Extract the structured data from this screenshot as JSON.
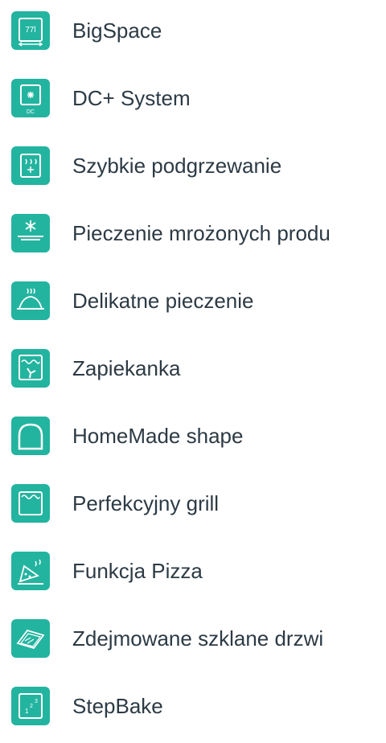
{
  "colors": {
    "icon_background": "#23b4a0",
    "icon_stroke": "#ffffff",
    "label_text": "#2c3a44"
  },
  "features": [
    {
      "label": "BigSpace",
      "icon": "bigspace-oven-icon"
    },
    {
      "label": "DC+ System",
      "icon": "dc-system-icon"
    },
    {
      "label": "Szybkie podgrzewanie",
      "icon": "fast-preheat-icon"
    },
    {
      "label": "Pieczenie mrożonych produ",
      "icon": "frozen-baking-icon"
    },
    {
      "label": "Delikatne pieczenie",
      "icon": "gentle-baking-icon"
    },
    {
      "label": "Zapiekanka",
      "icon": "casserole-fan-icon"
    },
    {
      "label": "HomeMade shape",
      "icon": "homemade-arch-icon"
    },
    {
      "label": "Perfekcyjny grill",
      "icon": "perfect-grill-icon"
    },
    {
      "label": "Funkcja Pizza",
      "icon": "pizza-icon"
    },
    {
      "label": "Zdejmowane szklane drzwi",
      "icon": "removable-glass-door-icon"
    },
    {
      "label": "StepBake",
      "icon": "stepbake-icon"
    }
  ]
}
